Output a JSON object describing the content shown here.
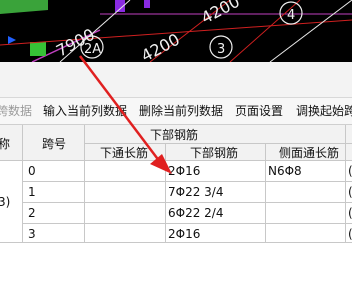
{
  "cad": {
    "labels": {
      "dim_7900": "7900",
      "dim_4200_top": "4200",
      "dim_4200_mid": "4200",
      "axis_2a": "2A",
      "axis_3": "3",
      "axis_4": "4"
    }
  },
  "toolbar": {
    "items": [
      "跨数据",
      "输入当前列数据",
      "删除当前列数据",
      "页面设置",
      "调换起始跨"
    ]
  },
  "table": {
    "left_stub_header": "称",
    "left_stub_value": "3)",
    "col_span_no": "跨号",
    "group_header": "下部钢筋",
    "sub_headers": [
      "下通长筋",
      "下部钢筋",
      "侧面通长筋"
    ],
    "rows": [
      {
        "span": "0",
        "bottom_through": "",
        "bottom_rebar": "2Φ16",
        "side_rebar": "N6Φ8"
      },
      {
        "span": "1",
        "bottom_through": "",
        "bottom_rebar": "7Φ22 3/4",
        "side_rebar": ""
      },
      {
        "span": "2",
        "bottom_through": "",
        "bottom_rebar": "6Φ22 2/4",
        "side_rebar": ""
      },
      {
        "span": "3",
        "bottom_through": "",
        "bottom_rebar": "2Φ16",
        "side_rebar": ""
      }
    ],
    "right_edge_values": [
      "(",
      "(",
      "(",
      "("
    ]
  },
  "colors": {
    "annotation_arrow": "#e02020",
    "cad_background": "#000000"
  }
}
